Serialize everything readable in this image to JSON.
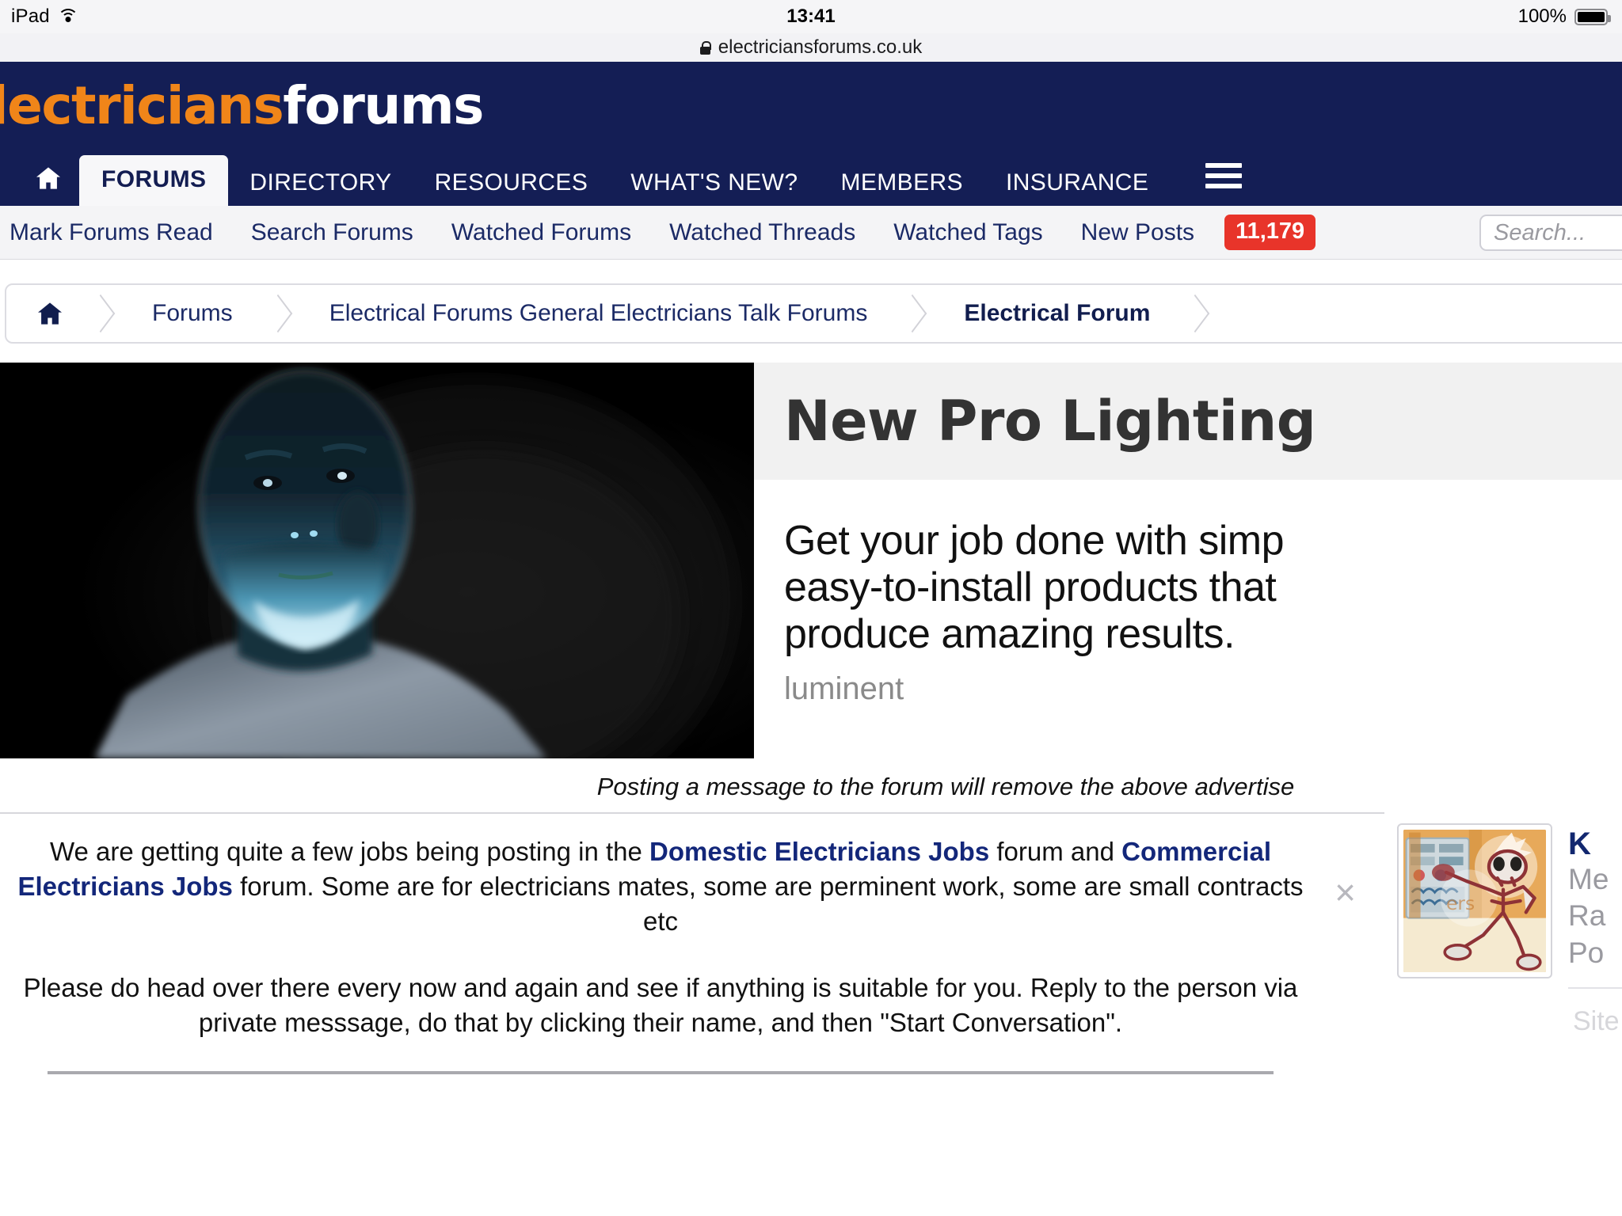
{
  "status_bar": {
    "carrier": "iPad",
    "wifi_icon": "wifi-icon",
    "time": "13:41",
    "battery_percent": "100%",
    "battery_icon": "battery-full-icon"
  },
  "url_bar": {
    "lock_icon": "lock-icon",
    "url": "electriciansforums.co.uk"
  },
  "header": {
    "logo_part1": "lectricians",
    "logo_part2": "forums",
    "logo_color_1": "#f08519",
    "logo_color_2": "#ffffff",
    "background": "#141e55",
    "home_icon": "home-icon",
    "menu_icon": "hamburger-menu-icon",
    "nav": [
      {
        "label": "FORUMS",
        "active": true
      },
      {
        "label": "DIRECTORY",
        "active": false
      },
      {
        "label": "RESOURCES",
        "active": false
      },
      {
        "label": "WHAT'S NEW?",
        "active": false
      },
      {
        "label": "MEMBERS",
        "active": false
      },
      {
        "label": "INSURANCE",
        "active": false
      }
    ]
  },
  "sub_nav": {
    "links": [
      "Mark Forums Read",
      "Search Forums",
      "Watched Forums",
      "Watched Threads",
      "Watched Tags",
      "New Posts"
    ],
    "new_posts_count": "11,179",
    "badge_color": "#e8342a",
    "search_placeholder": "Search...",
    "search_value": ""
  },
  "breadcrumb": {
    "home_icon": "home-icon",
    "items": [
      {
        "label": "Forums",
        "current": false
      },
      {
        "label": "Electrical Forums General Electricians Talk Forums",
        "current": false
      },
      {
        "label": "Electrical Forum",
        "current": true
      }
    ]
  },
  "ad": {
    "image_alt": "dark-portrait-blue-light",
    "heading": "New Pro Lighting",
    "description": "Get your job done with simp",
    "description_line2": "easy-to-install products that",
    "description_line3": "produce amazing results.",
    "brand": "luminent",
    "notice": "Posting a message to the forum will remove the above advertise"
  },
  "notice": {
    "close_icon": "close-icon",
    "para1_a": "We are getting quite a few jobs being posting in the ",
    "para1_link1": "Domestic Electricians Jobs",
    "para1_b": " forum and ",
    "para1_link2": "Commercial Electricians Jobs",
    "para1_c": " forum. Some are for electricians mates, some are perminent work, some are small contracts etc",
    "para2": "Please do head over there every now and again and see if anything is suitable for you. Reply to the person via private messsage, do that by clicking their name, and then \"Start Conversation\"."
  },
  "sidebar": {
    "avatar_alt": "electrocuted-skeleton-avatar",
    "title": "K",
    "line1": "Me",
    "line2": "Ra",
    "line3": "Po",
    "footer": "Site Supporter"
  }
}
